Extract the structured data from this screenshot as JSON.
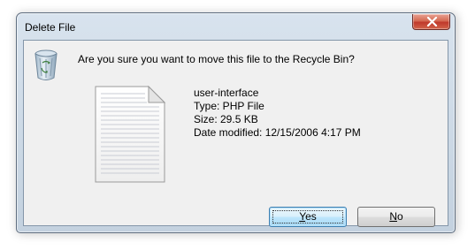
{
  "window": {
    "title": "Delete File"
  },
  "dialog": {
    "question": "Are you sure you want to move this file to the Recycle Bin?",
    "icon": "recycle-bin-icon"
  },
  "file": {
    "icon": "file-icon",
    "name": "user-interface",
    "type": "Type: PHP File",
    "size": "Size: 29.5 KB",
    "modified": "Date modified: 12/15/2006 4:17 PM"
  },
  "buttons": {
    "yes_mnemonic": "Y",
    "yes_rest": "es",
    "no_mnemonic": "N",
    "no_rest": "o"
  },
  "colors": {
    "close_button": "#c0392b",
    "default_button_border": "#3c7fb1"
  }
}
